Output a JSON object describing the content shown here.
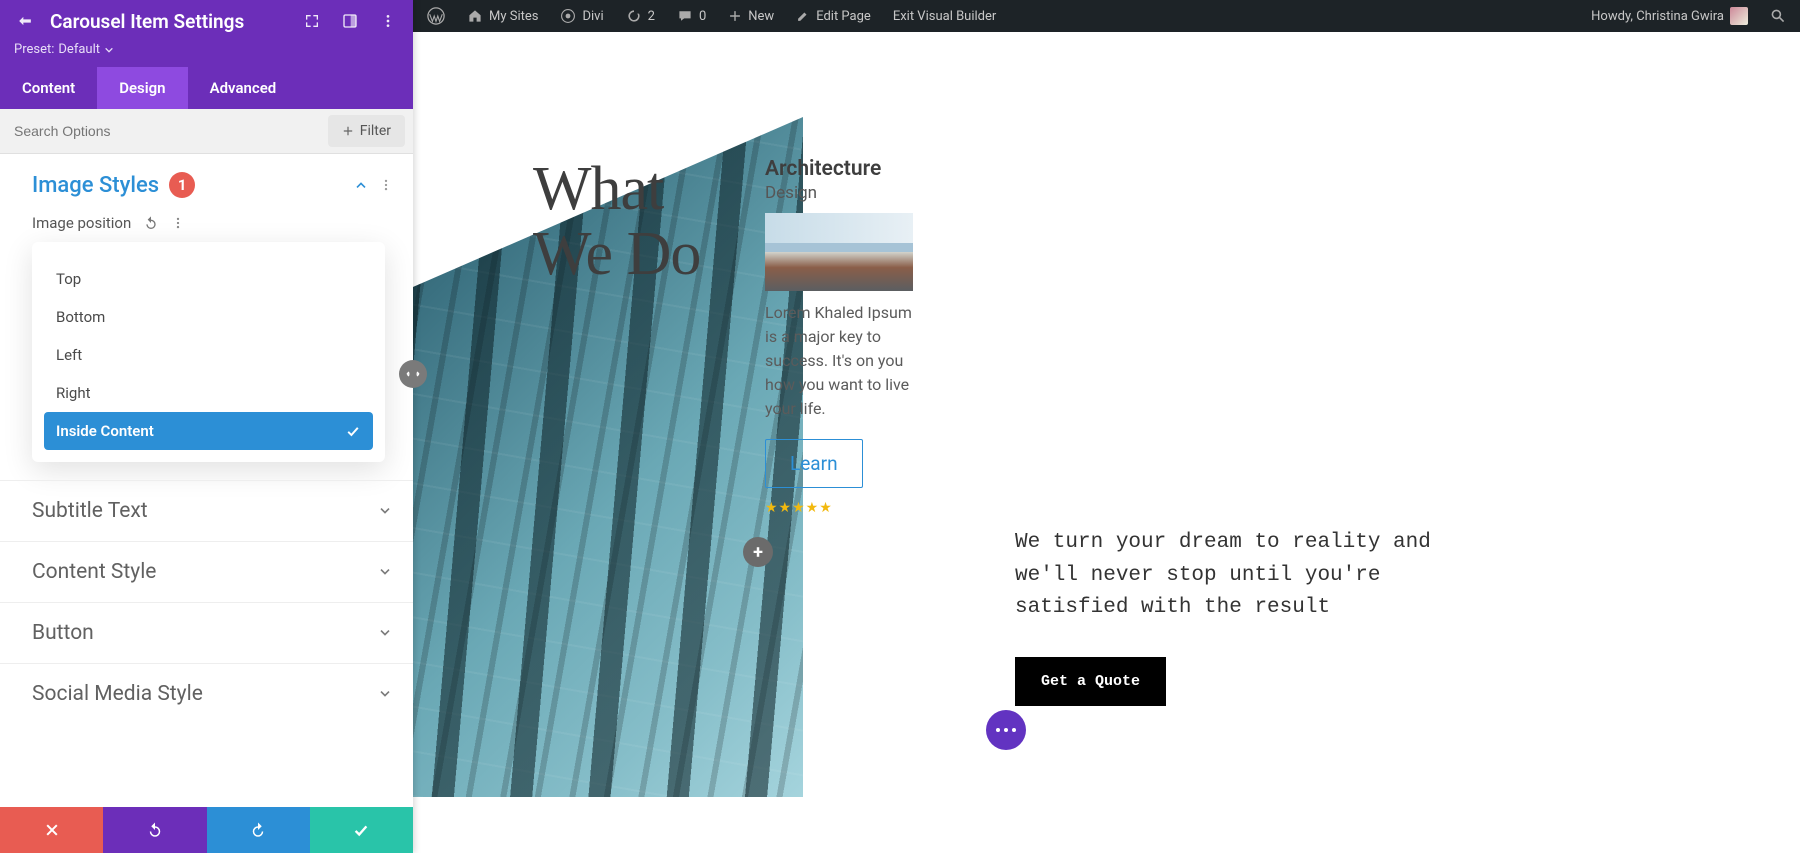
{
  "wpbar": {
    "mysites": "My Sites",
    "divi": "Divi",
    "updates": "2",
    "comments": "0",
    "new": "New",
    "edit": "Edit Page",
    "exit": "Exit Visual Builder",
    "howdy": "Howdy, Christina Gwira"
  },
  "panel": {
    "title": "Carousel Item Settings",
    "preset_label": "Preset:",
    "preset_value": "Default",
    "tabs": {
      "content": "Content",
      "design": "Design",
      "advanced": "Advanced"
    },
    "search_placeholder": "Search Options",
    "filter": "Filter",
    "section_title": "Image Styles",
    "badge": "1",
    "field_label": "Image position",
    "options": {
      "top": "Top",
      "bottom": "Bottom",
      "left": "Left",
      "right": "Right",
      "inside": "Inside Content"
    },
    "collapsed": {
      "subtitle": "Subtitle Text",
      "content_style": "Content Style",
      "button": "Button",
      "social": "Social Media Style"
    }
  },
  "page": {
    "heading_line1": "What",
    "heading_line2": "We Do",
    "card": {
      "title": "Architecture",
      "subtitle": "Design",
      "body": "Lorem Khaled Ipsum is a major key to success. It's on you how you want to live your life.",
      "button": "Learn",
      "stars": "★★★★★"
    },
    "hero": "We turn your dream to reality and we'll never stop until you're satisfied with the result",
    "quote": "Get a Quote"
  }
}
